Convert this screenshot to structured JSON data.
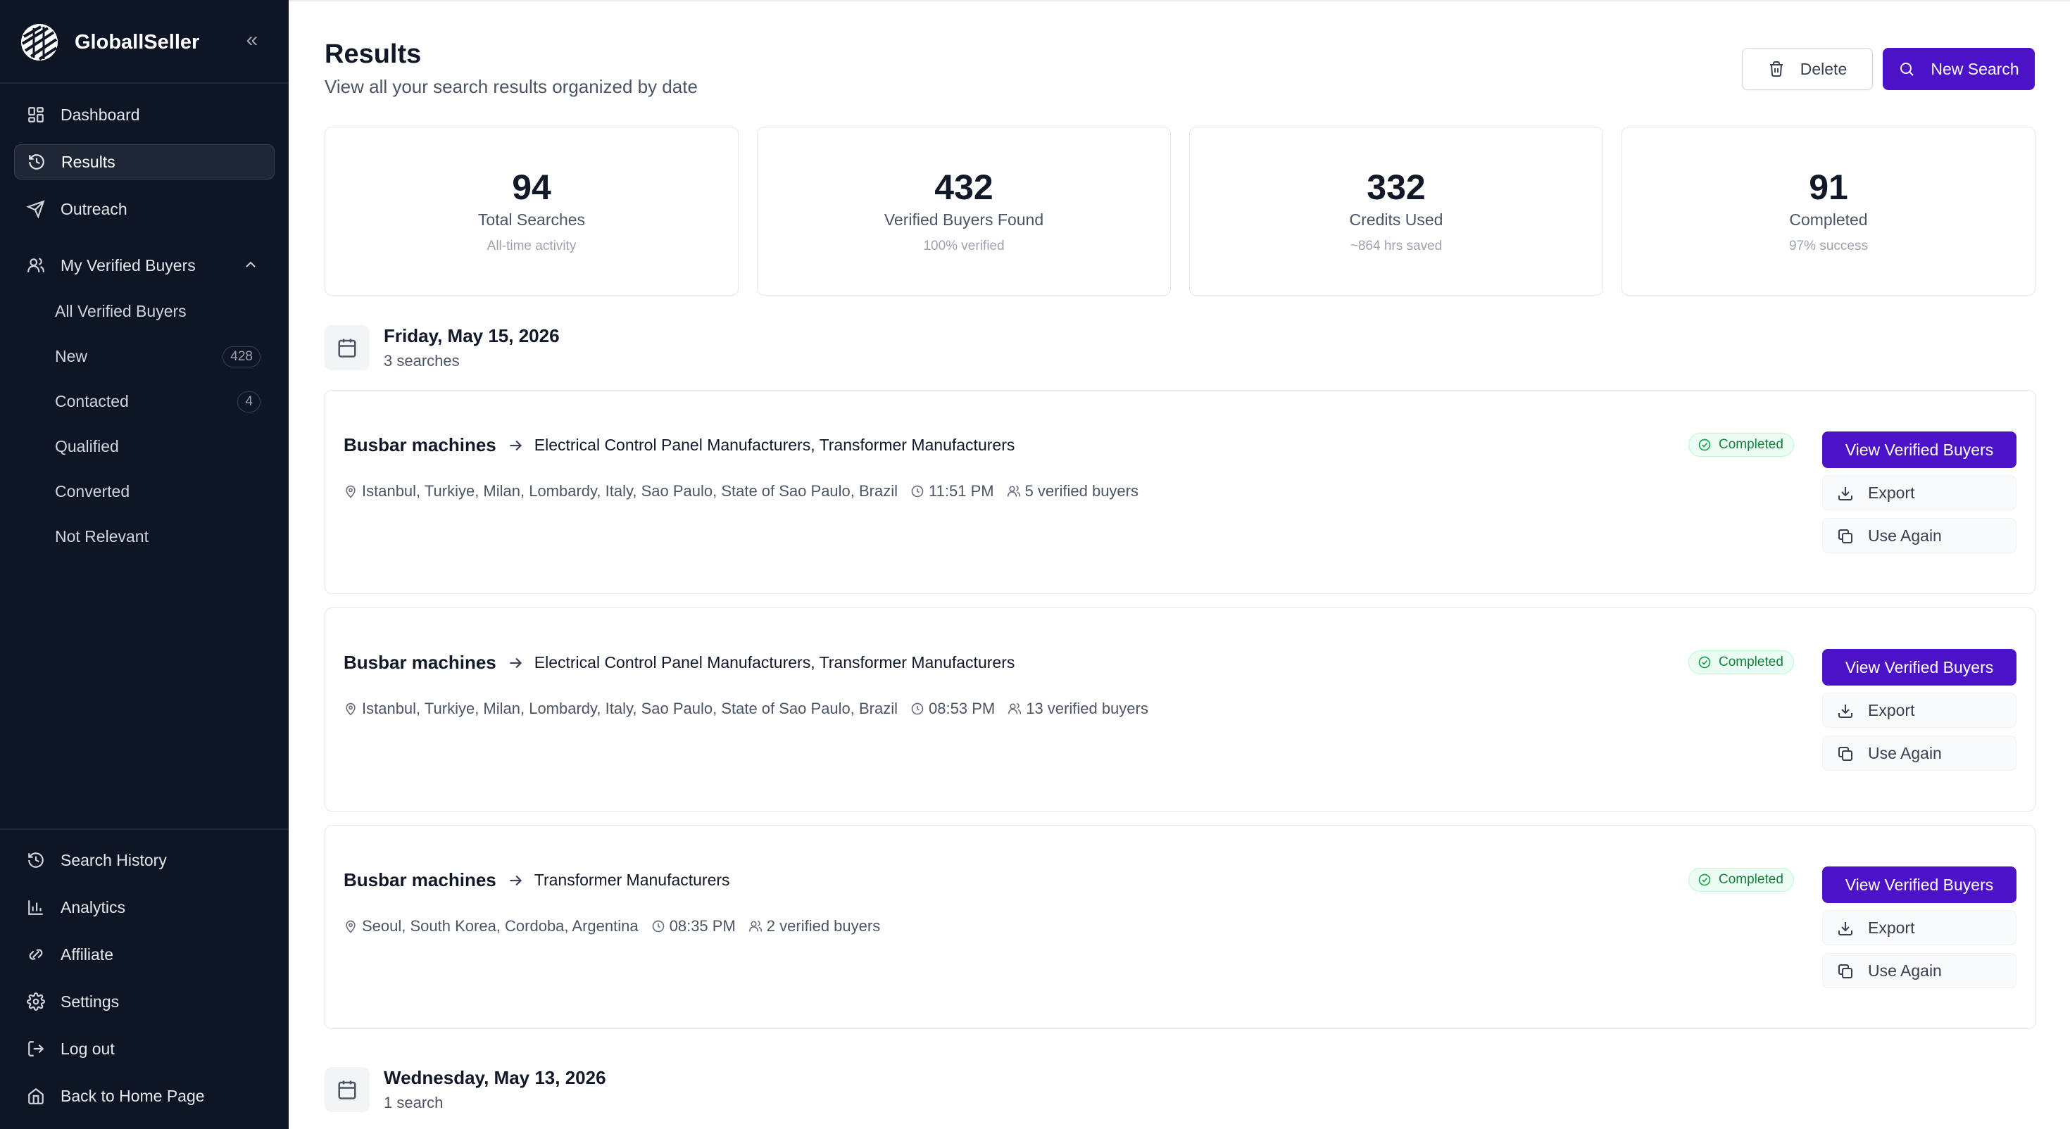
{
  "sidebar": {
    "brand": "GloballSeller",
    "collapse_icon": "«",
    "nav": [
      {
        "label": "Dashboard",
        "icon": "grid-icon"
      },
      {
        "label": "Results",
        "icon": "history-icon",
        "active": true
      },
      {
        "label": "Outreach",
        "icon": "send-icon"
      }
    ],
    "verified_buyers": {
      "label": "My Verified Buyers",
      "items": [
        {
          "label": "All Verified Buyers"
        },
        {
          "label": "New",
          "badge": "428"
        },
        {
          "label": "Contacted",
          "badge": "4"
        },
        {
          "label": "Qualified"
        },
        {
          "label": "Converted"
        },
        {
          "label": "Not Relevant"
        }
      ]
    },
    "bottom_nav": [
      {
        "label": "Search History",
        "icon": "history-icon"
      },
      {
        "label": "Analytics",
        "icon": "bar-chart-icon"
      },
      {
        "label": "Affiliate",
        "icon": "affiliate-icon"
      },
      {
        "label": "Settings",
        "icon": "gear-icon"
      },
      {
        "label": "Log out",
        "icon": "logout-icon"
      },
      {
        "label": "Back to Home Page",
        "icon": "home-icon"
      }
    ]
  },
  "header": {
    "title": "Results",
    "subtitle": "View all your search results organized by date",
    "delete_label": "Delete",
    "new_search_label": "New Search"
  },
  "stats": [
    {
      "value": "94",
      "label": "Total Searches",
      "hint": "All-time activity"
    },
    {
      "value": "432",
      "label": "Verified Buyers Found",
      "hint": "100% verified"
    },
    {
      "value": "332",
      "label": "Credits Used",
      "hint": "~864 hrs saved"
    },
    {
      "value": "91",
      "label": "Completed",
      "hint": "97% success"
    }
  ],
  "groups": [
    {
      "date": "Friday, May 15, 2026",
      "count": "3 searches",
      "results": [
        {
          "product": "Busbar machines",
          "targets": "Electrical Control Panel Manufacturers, Transformer Manufacturers",
          "locations": "Istanbul, Turkiye, Milan, Lombardy, Italy, Sao Paulo, State of Sao Paulo, Brazil",
          "time": "11:51 PM",
          "buyers": "5 verified buyers",
          "status": "Completed"
        },
        {
          "product": "Busbar machines",
          "targets": "Electrical Control Panel Manufacturers, Transformer Manufacturers",
          "locations": "Istanbul, Turkiye, Milan, Lombardy, Italy, Sao Paulo, State of Sao Paulo, Brazil",
          "time": "08:53 PM",
          "buyers": "13 verified buyers",
          "status": "Completed"
        },
        {
          "product": "Busbar machines",
          "targets": "Transformer Manufacturers",
          "locations": "Seoul, South Korea, Cordoba, Argentina",
          "time": "08:35 PM",
          "buyers": "2 verified buyers",
          "status": "Completed"
        }
      ]
    },
    {
      "date": "Wednesday, May 13, 2026",
      "count": "1 search",
      "results": []
    }
  ],
  "actions": {
    "view": "View Verified Buyers",
    "export": "Export",
    "use_again": "Use Again"
  },
  "colors": {
    "sidebar_bg": "#0e1525",
    "accent": "#4c12c7",
    "success": "#15803d"
  }
}
